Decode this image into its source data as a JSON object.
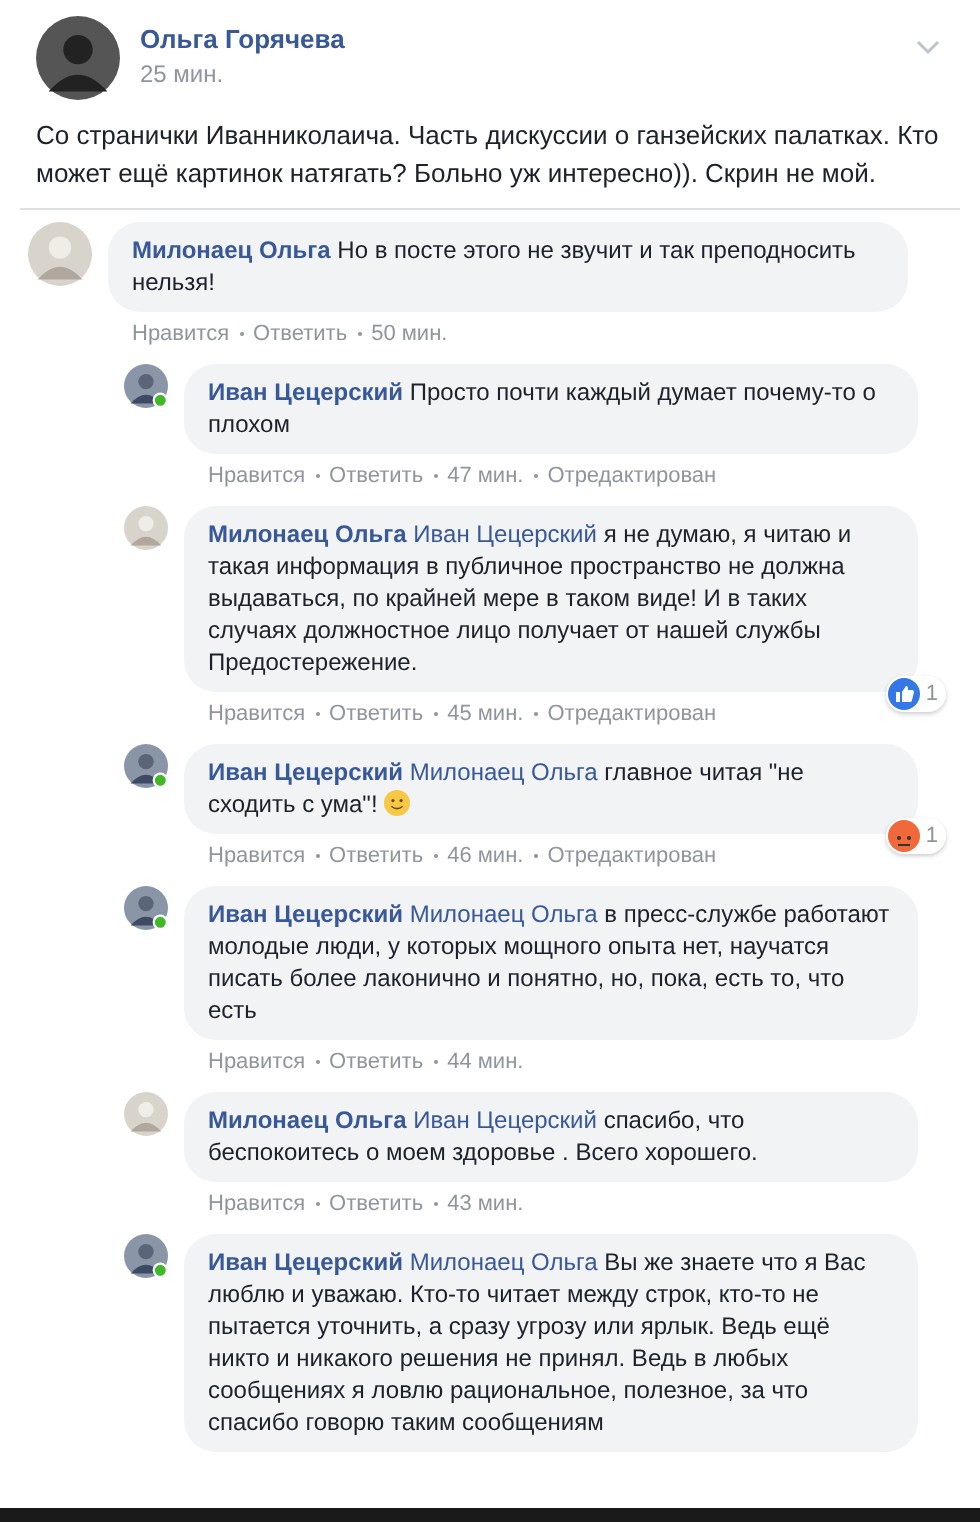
{
  "post": {
    "author": "Ольга Горячева",
    "time": "25 мин.",
    "text": "Со странички Иванниколаича. Часть дискуссии о ганзейских палатках. Кто может ещё картинок натягать? Больно уж интересно)). Скрин не мой."
  },
  "comments": [
    {
      "author": "Милонаец Ольга",
      "online": false,
      "text": "Но в посте этого не звучит и так преподносить нельзя!",
      "actions": [
        "Нравится",
        "Ответить",
        "50 мин."
      ],
      "replies": [
        {
          "author": "Иван Цецерский",
          "online": true,
          "text": "Просто почти каждый думает почему-то о плохом",
          "actions": [
            "Нравится",
            "Ответить",
            "47 мин.",
            "Отредактирован"
          ]
        },
        {
          "author": "Милонаец Ольга",
          "online": false,
          "mention": "Иван Цецерский",
          "text": "я не думаю, я читаю и такая информация в публичное пространство не должна выдаваться, по крайней мере в таком виде! И в таких случаях должностное лицо получает от нашей службы Предостережение.",
          "actions": [
            "Нравится",
            "Ответить",
            "45 мин.",
            "Отредактирован"
          ],
          "reaction": {
            "kind": "like",
            "count": "1"
          }
        },
        {
          "author": "Иван Цецерский",
          "online": true,
          "mention": "Милонаец Ольга",
          "text": "главное читая \"не сходить с ума\"!",
          "emoji": true,
          "actions": [
            "Нравится",
            "Ответить",
            "46 мин.",
            "Отредактирован"
          ],
          "reaction": {
            "kind": "angry",
            "count": "1"
          }
        },
        {
          "author": "Иван Цецерский",
          "online": true,
          "mention": "Милонаец Ольга",
          "text": "в пресс-службе работают молодые люди, у которых мощного опыта нет, научатся писать более лаконично и понятно, но, пока, есть то, что есть",
          "actions": [
            "Нравится",
            "Ответить",
            "44 мин."
          ]
        },
        {
          "author": "Милонаец Ольга",
          "online": false,
          "mention": "Иван Цецерский",
          "text": "спасибо, что беспокоитесь о моем здоровье . Всего хорошего.",
          "actions": [
            "Нравится",
            "Ответить",
            "43 мин."
          ]
        },
        {
          "author": "Иван Цецерский",
          "online": true,
          "mention": "Милонаец Ольга",
          "text": "Вы же знаете что я Вас люблю и уважаю. Кто-то читает между строк, кто-то не пытается уточнить, а сразу угрозу или ярлык. Ведь ещё никто и никакого решения не принял. Ведь в любых сообщениях я ловлю рациональное, полезное, за что спасибо говорю таким сообщениям"
        }
      ]
    }
  ]
}
